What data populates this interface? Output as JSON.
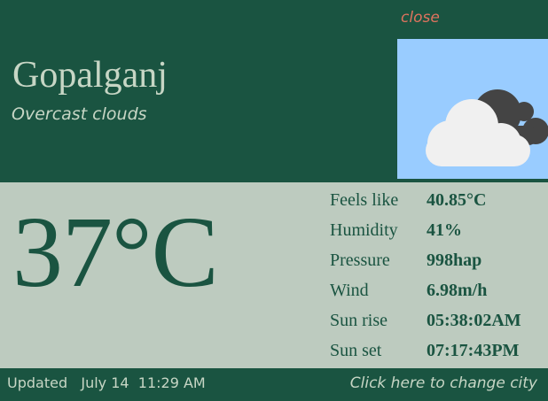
{
  "header": {
    "close_label": "close",
    "city": "Gopalganj",
    "description": "Overcast clouds",
    "icon": "overcast-clouds-icon"
  },
  "current": {
    "temperature": "37°C"
  },
  "stats": [
    {
      "label": "Feels like",
      "value": "40.85°C"
    },
    {
      "label": "Humidity",
      "value": "41%"
    },
    {
      "label": "Pressure",
      "value": "998hap"
    },
    {
      "label": "Wind",
      "value": "6.98m/h"
    },
    {
      "label": "Sun rise",
      "value": "05:38:02AM"
    },
    {
      "label": "Sun set",
      "value": "07:17:43PM"
    }
  ],
  "footer": {
    "updated_label": "Updated",
    "updated_date": "July 14",
    "updated_time": "11:29 AM",
    "change_city": "Click here to change city"
  },
  "colors": {
    "primary": "#1a5441",
    "panel": "#bdcbbf",
    "text_light": "#c7d6c5",
    "close": "#e0735e",
    "sky": "#99ccff"
  }
}
